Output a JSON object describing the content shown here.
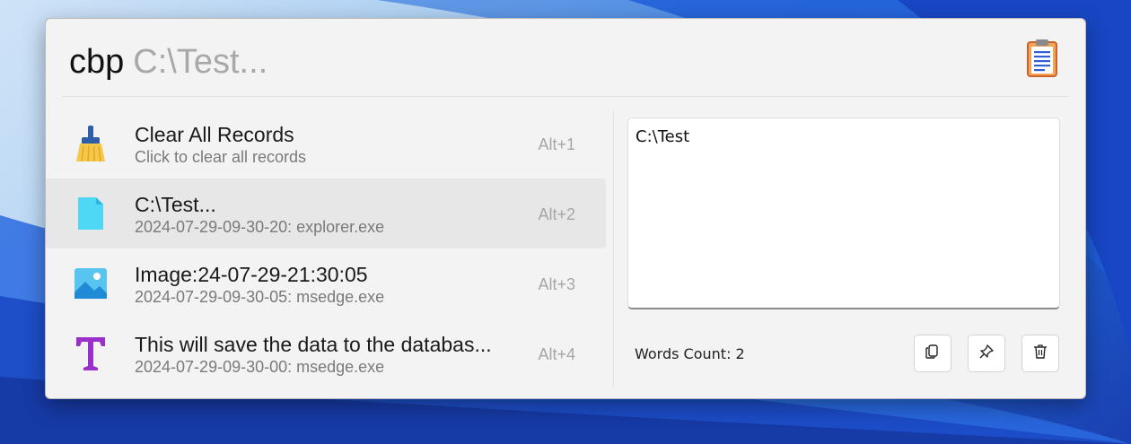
{
  "header": {
    "command": "cbp",
    "argument": "C:\\Test..."
  },
  "icons": {
    "clipboard": "clipboard-icon",
    "broom": "broom-icon",
    "file": "file-icon",
    "image": "image-icon",
    "text": "text-icon"
  },
  "items": [
    {
      "title": "Clear All Records",
      "subtitle": "Click to clear all records",
      "hotkey": "Alt+1",
      "icon": "broom-icon"
    },
    {
      "title": "C:\\Test...",
      "subtitle": "2024-07-29-09-30-20: explorer.exe",
      "hotkey": "Alt+2",
      "icon": "file-icon"
    },
    {
      "title": "Image:24-07-29-21:30:05",
      "subtitle": "2024-07-29-09-30-05: msedge.exe",
      "hotkey": "Alt+3",
      "icon": "image-icon"
    },
    {
      "title": "This will save the data to the databas...",
      "subtitle": "2024-07-29-09-30-00: msedge.exe",
      "hotkey": "Alt+4",
      "icon": "text-icon"
    }
  ],
  "preview": {
    "text": "C:\\Test"
  },
  "footer": {
    "words_label": "Words Count: 2"
  },
  "colors": {
    "accent_text_icon": "#9b2fc9",
    "file_icon": "#4fd8f5",
    "window_bg": "#f3f3f3"
  }
}
